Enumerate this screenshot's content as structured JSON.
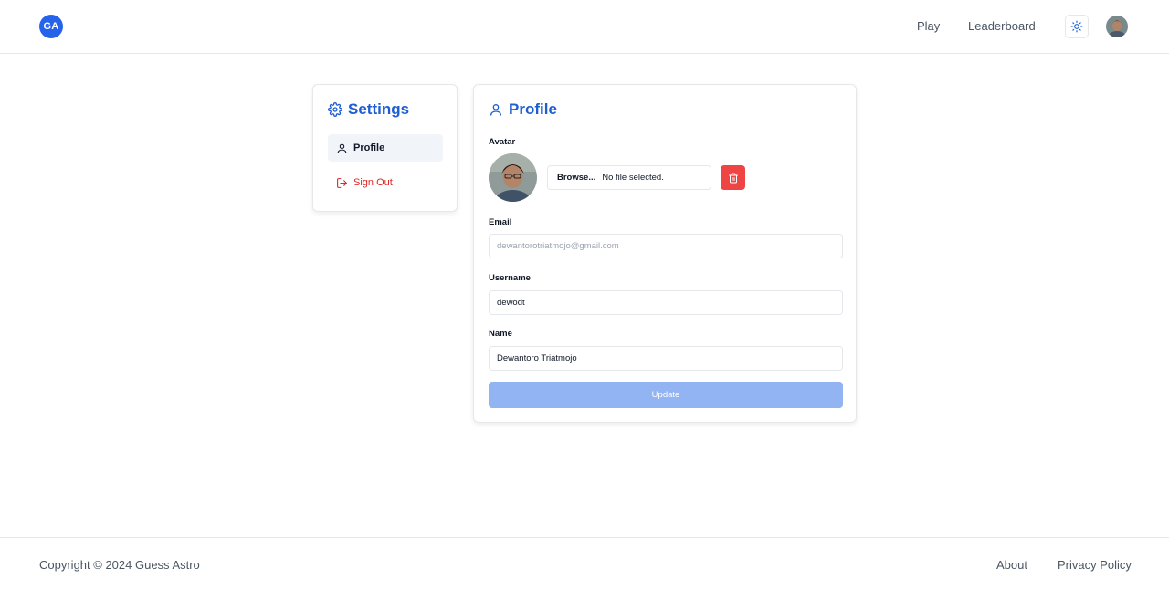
{
  "header": {
    "logo_text": "GA",
    "nav": {
      "play": "Play",
      "leaderboard": "Leaderboard"
    }
  },
  "settings": {
    "title": "Settings",
    "items": [
      {
        "label": "Profile",
        "icon": "user-icon",
        "active": true
      },
      {
        "label": "Sign Out",
        "icon": "sign-out-icon",
        "active": false
      }
    ]
  },
  "profile": {
    "title": "Profile",
    "avatar_label": "Avatar",
    "file_button": "Browse...",
    "file_status": "No file selected.",
    "email_label": "Email",
    "email_value": "dewantorotriatmojo@gmail.com",
    "username_label": "Username",
    "username_value": "dewodt",
    "name_label": "Name",
    "name_value": "Dewantoro Triatmojo",
    "update_label": "Update"
  },
  "footer": {
    "copyright": "Copyright © 2024 Guess Astro",
    "about": "About",
    "privacy": "Privacy Policy"
  },
  "colors": {
    "accent": "#2563eb",
    "title": "#1d5fd0",
    "danger": "#ef4444",
    "update_disabled": "#93b4f2"
  }
}
